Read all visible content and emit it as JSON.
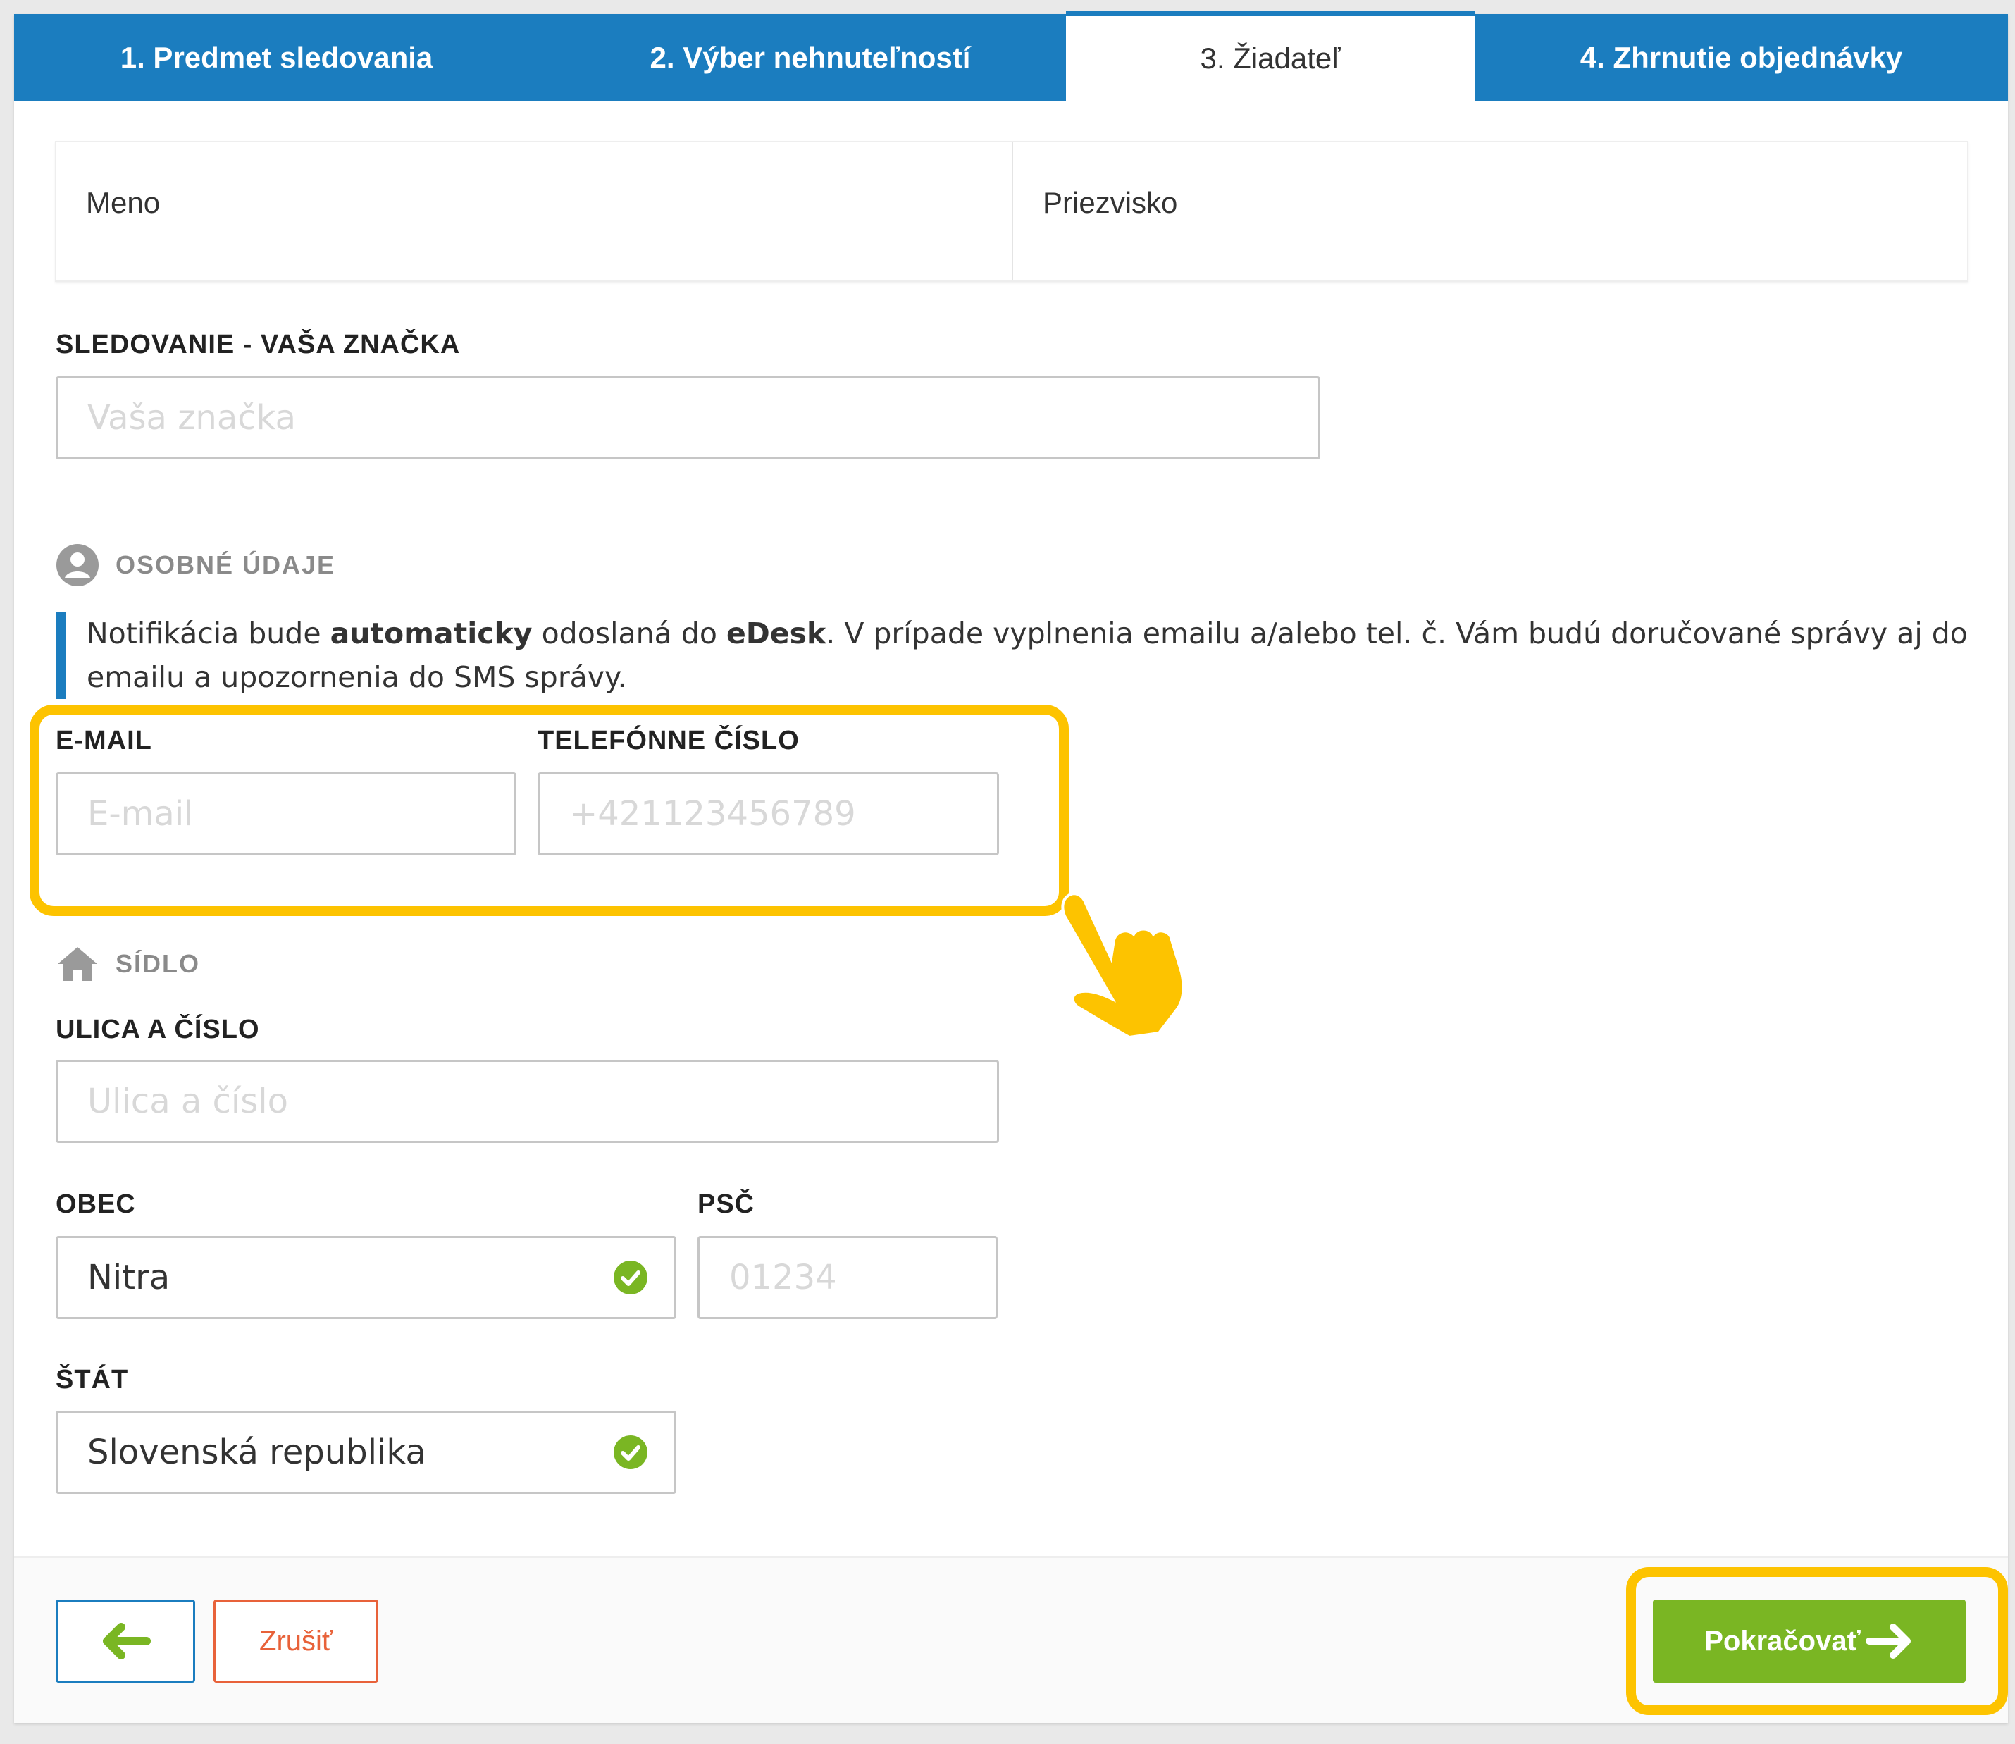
{
  "tabs": [
    {
      "label": "1. Predmet sledovania"
    },
    {
      "label": "2. Výber nehnuteľností"
    },
    {
      "label": "3. Žiadateľ"
    },
    {
      "label": "4. Zhrnutie objednávky"
    }
  ],
  "name_row": {
    "first_label": "Meno",
    "last_label": "Priezvisko"
  },
  "tag": {
    "label": "SLEDOVANIE - VAŠA ZNAČKA",
    "placeholder": "Vaša značka"
  },
  "personal": {
    "heading": "OSOBNÉ ÚDAJE",
    "icon": "user-circle-icon",
    "notice": {
      "part1": "Notifikácia bude ",
      "bold1": "automaticky",
      "part2": " odoslaná do ",
      "bold2": "eDesk",
      "part3": ". V prípade vyplnenia emailu a/alebo tel. č. Vám budú doručované správy aj do emailu a upozornenia do SMS správy."
    },
    "email": {
      "label": "E-MAIL",
      "placeholder": "E-mail"
    },
    "phone": {
      "label": "TELEFÓNNE ČÍSLO",
      "placeholder": "+421123456789"
    }
  },
  "seat": {
    "heading": "SÍDLO",
    "icon": "home-icon",
    "street": {
      "label": "ULICA A ČÍSLO",
      "placeholder": "Ulica a číslo"
    },
    "city": {
      "label": "OBEC",
      "value": "Nitra"
    },
    "zip": {
      "label": "PSČ",
      "placeholder": "01234"
    },
    "country": {
      "label": "ŠTÁT",
      "value": "Slovenská republika"
    }
  },
  "footer": {
    "back_icon": "arrow-left-icon",
    "cancel_label": "Zrušiť",
    "continue_label": "Pokračovať",
    "continue_icon": "arrow-right-icon"
  },
  "colors": {
    "tab_blue": "#1b7dbf",
    "highlight_yellow": "#fdc300",
    "green": "#7ab623",
    "cancel_red": "#e8623a"
  }
}
